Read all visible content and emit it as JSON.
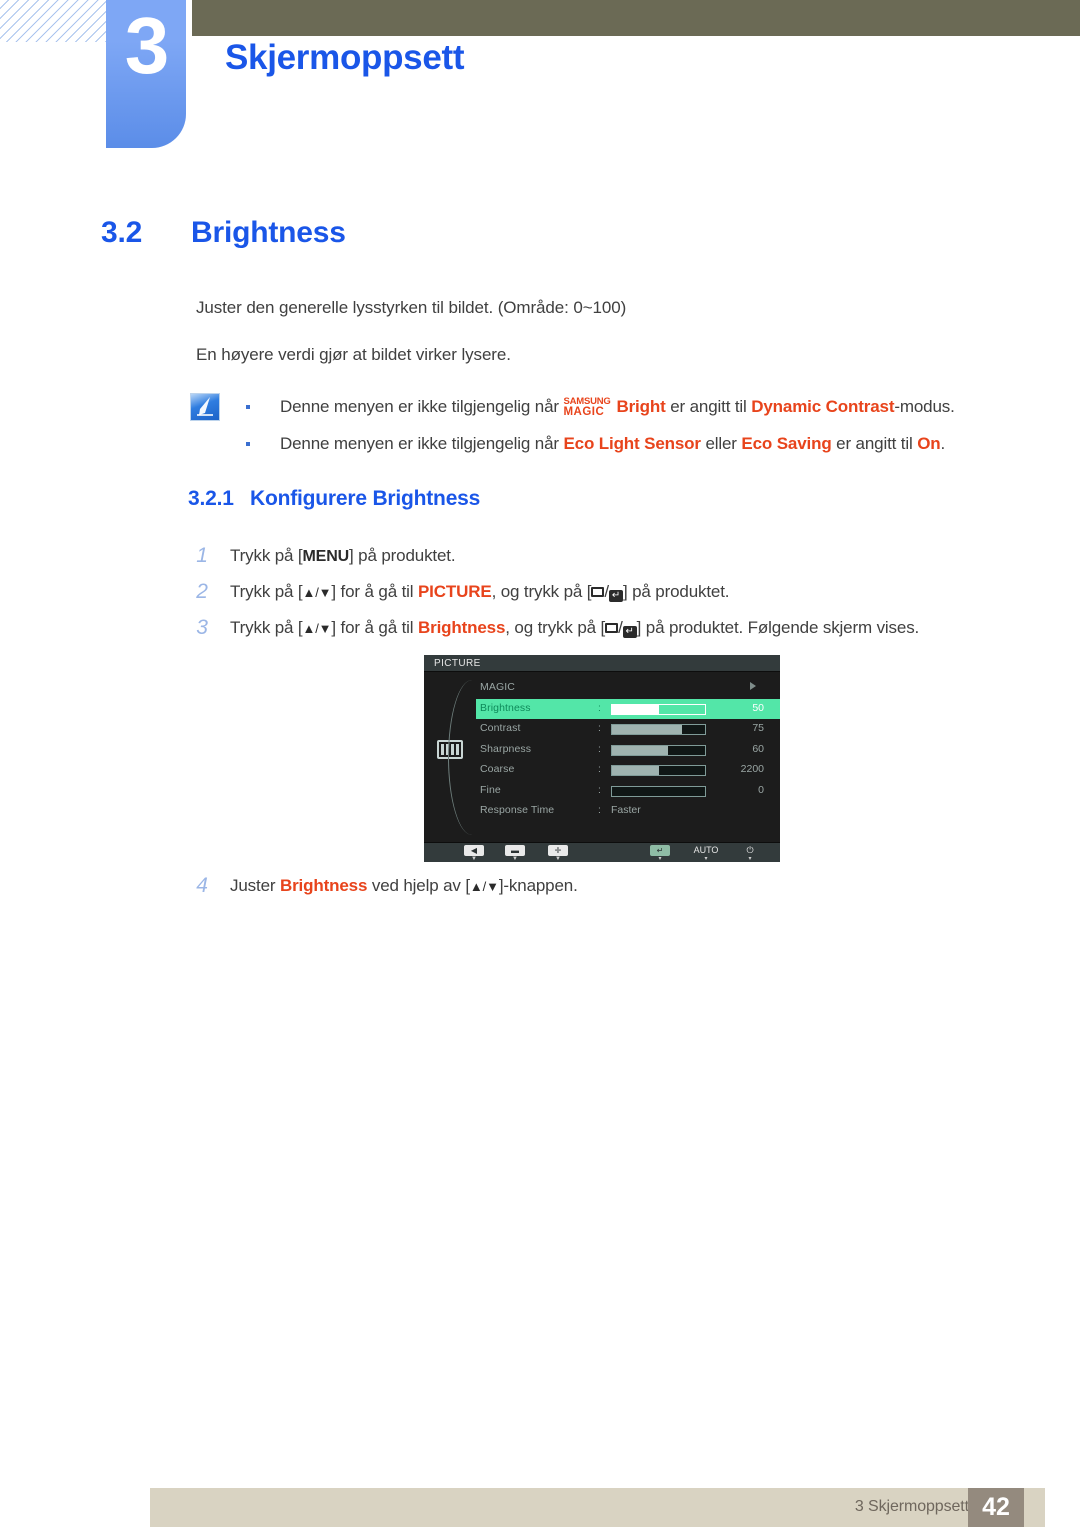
{
  "chapter": {
    "number": "3",
    "title": "Skjermoppsett"
  },
  "section": {
    "number": "3.2",
    "title": "Brightness"
  },
  "intro": {
    "line1": "Juster den generelle lysstyrken til bildet. (Område: 0~100)",
    "line2": "En høyere verdi gjør at bildet virker lysere."
  },
  "note": {
    "icon": "note-pencil-icon",
    "items": [
      {
        "pre": "Denne menyen er ikke tilgjengelig når ",
        "magic_top": "SAMSUNG",
        "magic_bottom": "MAGIC",
        "bright": "Bright",
        "mid": " er angitt til ",
        "kw1": "Dynamic Contrast",
        "post": "-modus."
      },
      {
        "pre": "Denne menyen er ikke tilgjengelig når ",
        "kw1": "Eco Light Sensor",
        "mid": " eller ",
        "kw2": "Eco Saving",
        "mid2": " er angitt til ",
        "kw3": "On",
        "post": "."
      }
    ]
  },
  "subsection": {
    "number": "3.2.1",
    "title": "Konfigurere Brightness"
  },
  "steps": [
    {
      "n": "1",
      "a": "Trykk på [",
      "kbd": "MENU",
      "b": "] på produktet."
    },
    {
      "n": "2",
      "a": "Trykk på [",
      "arrows": "▲/▼",
      "b": "] for å gå til ",
      "kw": "PICTURE",
      "c": ", og trykk på [",
      "d": "] på produktet."
    },
    {
      "n": "3",
      "a": "Trykk på [",
      "arrows": "▲/▼",
      "b": "] for å gå til ",
      "kw": "Brightness",
      "c": ", og trykk på [",
      "d": "] på produktet. Følgende skjerm vises."
    },
    {
      "n": "4",
      "a": "Juster ",
      "kw": "Brightness",
      "b": " ved hjelp av [",
      "arrows": "▲/▼",
      "c": "]-knappen."
    }
  ],
  "osd": {
    "title": "PICTURE",
    "category_icon": "picture-bars-icon",
    "rows": [
      {
        "label": "MAGIC",
        "type": "submenu",
        "value": "",
        "percent": 0
      },
      {
        "label": "Brightness",
        "type": "slider",
        "value": "50",
        "percent": 50,
        "selected": true
      },
      {
        "label": "Contrast",
        "type": "slider",
        "value": "75",
        "percent": 75
      },
      {
        "label": "Sharpness",
        "type": "slider",
        "value": "60",
        "percent": 60
      },
      {
        "label": "Coarse",
        "type": "slider",
        "value": "2200",
        "percent": 50
      },
      {
        "label": "Fine",
        "type": "slider",
        "value": "0",
        "percent": 0
      },
      {
        "label": "Response Time",
        "type": "text",
        "value": "Faster"
      }
    ],
    "footer_buttons": [
      {
        "name": "back-button",
        "glyph": "◀",
        "caret": "▼",
        "style": "chip"
      },
      {
        "name": "minus-button",
        "glyph": "▬",
        "caret": "▼",
        "style": "chip"
      },
      {
        "name": "plus-button",
        "glyph": "✛",
        "caret": "▼",
        "style": "chip"
      },
      {
        "name": "enter-button",
        "glyph": "↵",
        "caret": "▾",
        "style": "chip-green"
      },
      {
        "name": "auto-button",
        "glyph": "AUTO",
        "caret": "▾",
        "style": "text"
      },
      {
        "name": "power-button",
        "glyph": "⏻",
        "caret": "▾",
        "style": "text"
      }
    ],
    "colors": {
      "selected_row": "#53e6a8",
      "panel": "#1c1c1c",
      "titlebar": "#333b3c"
    }
  },
  "footer": {
    "text": "3 Skjermoppsett",
    "page": "42"
  },
  "colors": {
    "heading_blue": "#1a56e8",
    "keyword_red": "#e8441c",
    "header_band": "#6b6a55",
    "footer_band": "#d9d3c2",
    "page_box": "#948a7e"
  }
}
